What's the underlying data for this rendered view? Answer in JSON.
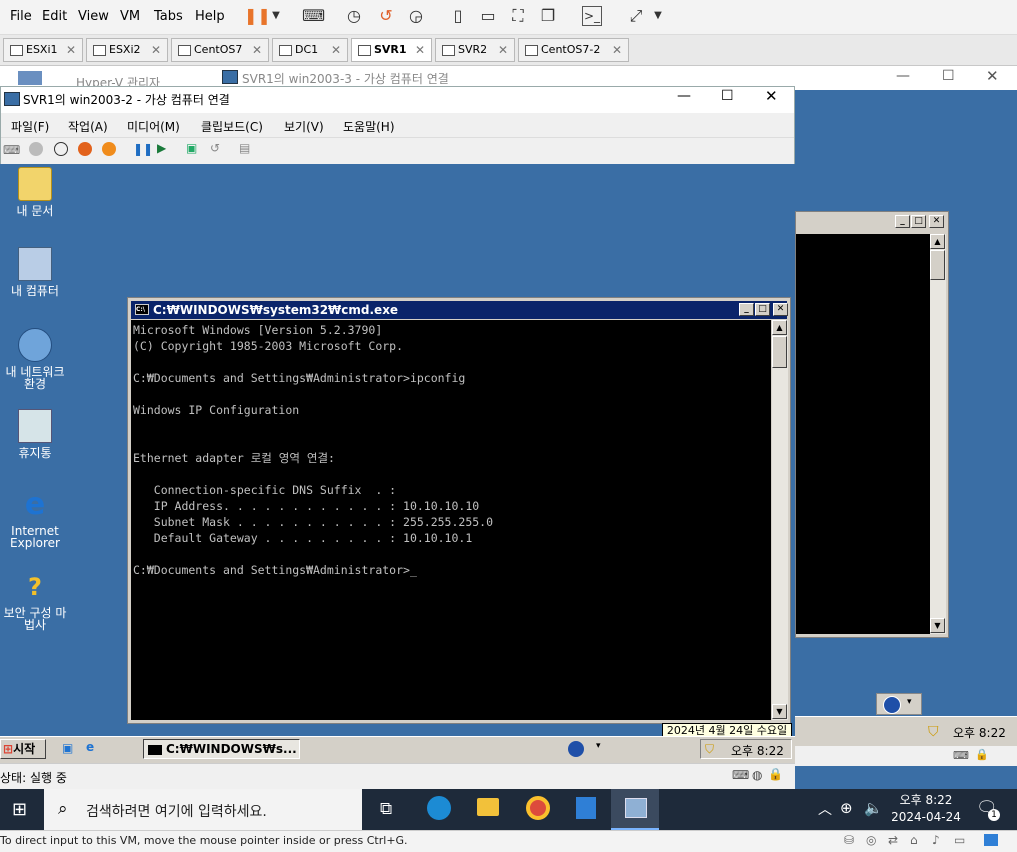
{
  "vmware": {
    "menu": [
      "File",
      "Edit",
      "View",
      "VM",
      "Tabs",
      "Help"
    ],
    "tabs": [
      {
        "label": "ESXi1",
        "active": false
      },
      {
        "label": "ESXi2",
        "active": false
      },
      {
        "label": "CentOS7",
        "active": false
      },
      {
        "label": "DC1",
        "active": false
      },
      {
        "label": "SVR1",
        "active": true
      },
      {
        "label": "SVR2",
        "active": false
      },
      {
        "label": "CentOS7-2",
        "active": false
      }
    ],
    "bottom_hint": "To direct input to this VM, move the mouse pointer inside or press Ctrl+G."
  },
  "behind_windows": {
    "hyperv_title": "Hyper-V 관리자",
    "win2003_3_title": "SVR1의 win2003-3 - 가상 컴퓨터 연결"
  },
  "vmconnect": {
    "title": "SVR1의 win2003-2 - 가상 컴퓨터 연결",
    "menu": [
      "파일(F)",
      "작업(A)",
      "미디어(M)",
      "클립보드(C)",
      "보기(V)",
      "도움말(H)"
    ],
    "status": "상태: 실행 중"
  },
  "desktop_icons": [
    {
      "label": "내 문서",
      "icon": "folder-documents-icon"
    },
    {
      "label": "내 컴퓨터",
      "icon": "computer-icon"
    },
    {
      "label": "내 네트워크 환경",
      "icon": "network-icon"
    },
    {
      "label": "휴지통",
      "icon": "recycle-bin-icon"
    },
    {
      "label": "Internet Explorer",
      "icon": "ie-icon"
    },
    {
      "label": "보안 구성 마법사",
      "icon": "security-wizard-icon"
    }
  ],
  "cmd": {
    "title": "C:₩WINDOWS₩system32₩cmd.exe",
    "lines": [
      "Microsoft Windows [Version 5.2.3790]",
      "(C) Copyright 1985-2003 Microsoft Corp.",
      "",
      "C:₩Documents and Settings₩Administrator>ipconfig",
      "",
      "Windows IP Configuration",
      "",
      "",
      "Ethernet adapter 로컬 영역 연결:",
      "",
      "   Connection-specific DNS Suffix  . :",
      "   IP Address. . . . . . . . . . . . : 10.10.10.10",
      "   Subnet Mask . . . . . . . . . . . : 255.255.255.0",
      "   Default Gateway . . . . . . . . . : 10.10.10.1",
      "",
      "C:₩Documents and Settings₩Administrator>"
    ]
  },
  "xp_taskbar": {
    "start": "시작",
    "task": "C:₩WINDOWS₩s...",
    "clock": "오후 8:22",
    "date_tooltip": "2024년 4월 24일 수요일"
  },
  "behind_taskbar_clock": "오후 8:22",
  "win10": {
    "search_placeholder": "검색하려면 여기에 입력하세요.",
    "time": "오후 8:22",
    "date": "2024-04-24",
    "notification_count": "1"
  }
}
